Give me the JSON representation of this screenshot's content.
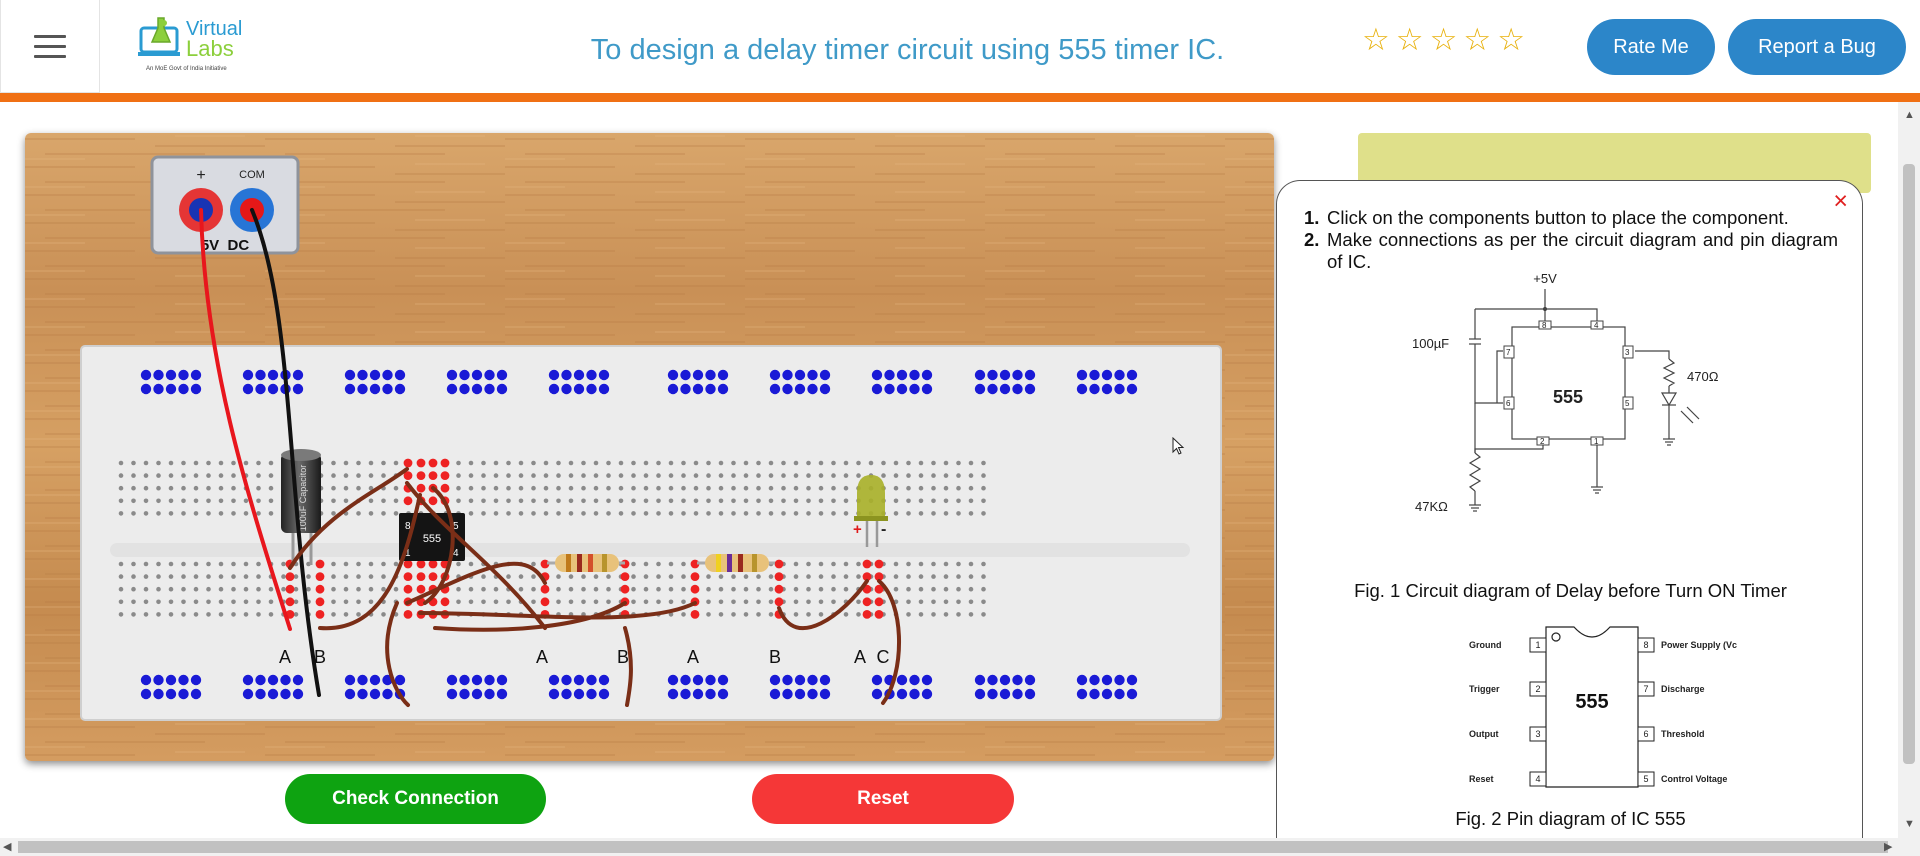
{
  "header": {
    "logo_name": "Virtual",
    "logo_name2": "Labs",
    "logo_tagline": "An MoE Govt of India Initiative",
    "title": "To design a delay timer circuit using 555 timer IC.",
    "rate_label": "Rate Me",
    "bug_label": "Report a Bug",
    "stars": [
      "☆",
      "☆",
      "☆",
      "☆",
      "☆"
    ]
  },
  "board": {
    "supply_plus": "+",
    "supply_com": "COM",
    "supply_label": "5V  DC",
    "ic_label": "555",
    "ic_pin_8": "8",
    "ic_pin_5": "5",
    "ic_pin_1": "1",
    "ic_pin_4": "4",
    "capacitor_label": "100uF Capacitor",
    "led_plus": "+",
    "led_minus": "-",
    "terminal_labels": [
      "A",
      "B",
      "A",
      "B",
      "A",
      "B",
      "A",
      "C"
    ]
  },
  "buttons": {
    "check": "Check Connection",
    "reset": "Reset"
  },
  "instructions": {
    "close": "×",
    "steps": [
      {
        "num": "1.",
        "text": "Click on the components button to place the component."
      },
      {
        "num": "2.",
        "text": "Make connections as per the circuit diagram and pin diagram of IC."
      }
    ],
    "fig1": {
      "supply": "+5V",
      "cap": "100µF",
      "res_top": "470Ω",
      "res_bottom": "47KΩ",
      "ic": "555",
      "pins": [
        "8",
        "4",
        "7",
        "3",
        "6",
        "5",
        "2",
        "1"
      ]
    },
    "fig1_caption": "Fig. 1 Circuit diagram of Delay before Turn ON Timer",
    "fig2": {
      "ic": "555",
      "left_pins": [
        {
          "num": "1",
          "name": "Ground"
        },
        {
          "num": "2",
          "name": "Trigger"
        },
        {
          "num": "3",
          "name": "Output"
        },
        {
          "num": "4",
          "name": "Reset"
        }
      ],
      "right_pins": [
        {
          "num": "8",
          "name": "Power Supply (Vc"
        },
        {
          "num": "7",
          "name": "Discharge"
        },
        {
          "num": "6",
          "name": "Threshold"
        },
        {
          "num": "5",
          "name": "Control Voltage"
        }
      ]
    },
    "fig2_caption": "Fig. 2 Pin diagram of IC 555"
  },
  "colors": {
    "accent_orange": "#f07014",
    "title_blue": "#3f9ac8",
    "button_blue": "#2c86c9",
    "check_green": "#0ea311",
    "reset_red": "#f53737",
    "star_gold": "#e8b10c",
    "panel_green": "#dfe08a"
  }
}
